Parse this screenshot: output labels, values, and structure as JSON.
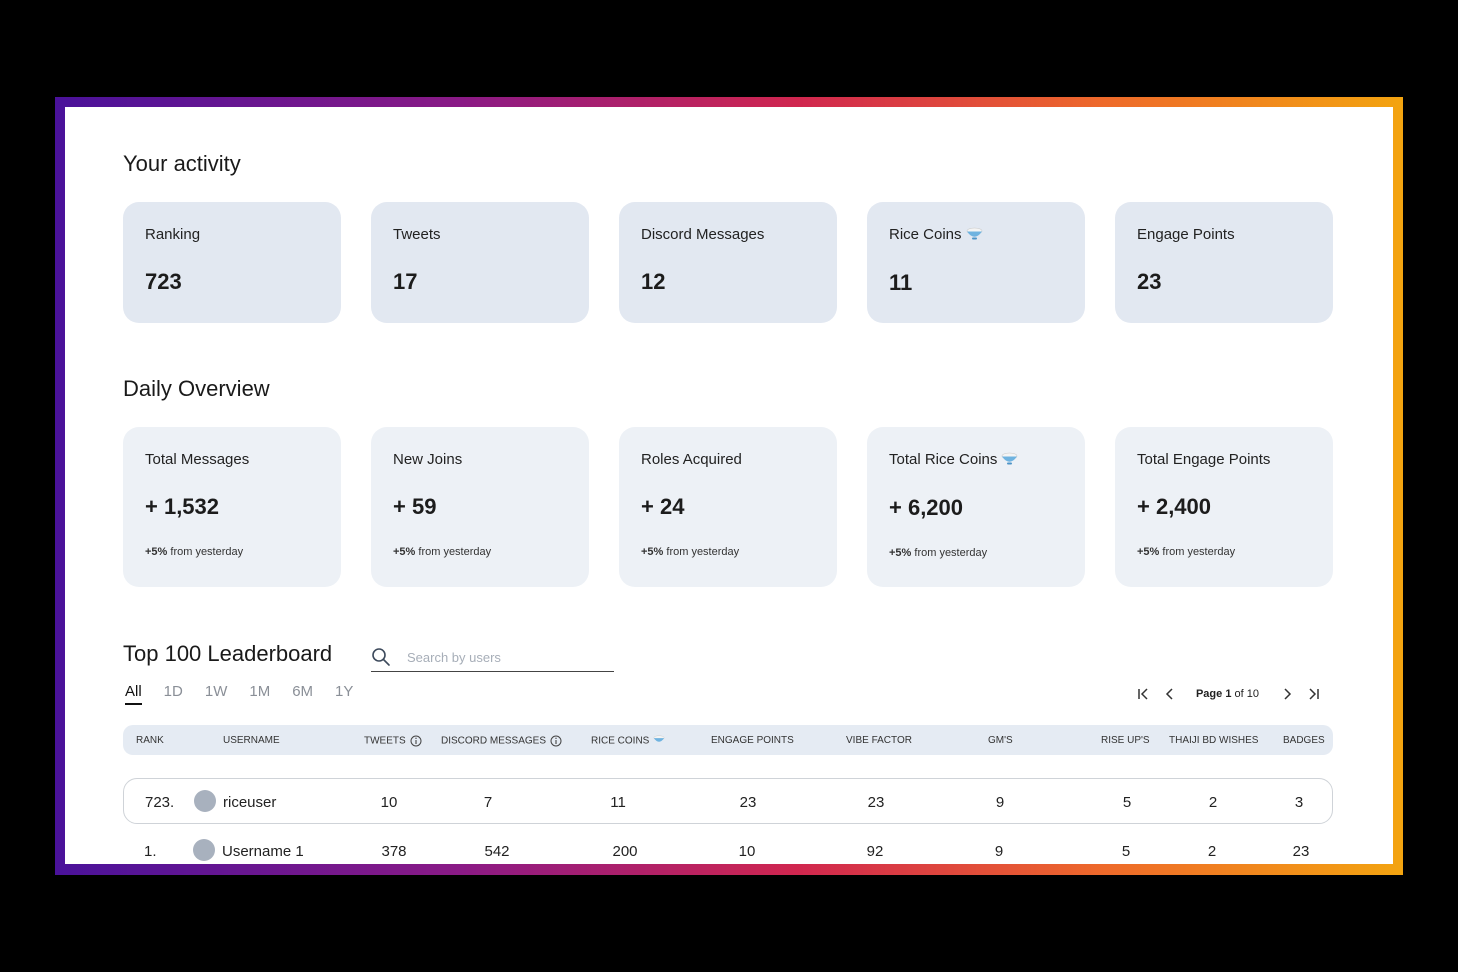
{
  "activity": {
    "title": "Your activity",
    "cards": [
      {
        "label": "Ranking",
        "value": "723"
      },
      {
        "label": "Tweets",
        "value": "17"
      },
      {
        "label": "Discord Messages",
        "value": "12"
      },
      {
        "label": "Rice Coins",
        "value": "11",
        "icon": "rice-bowl-icon"
      },
      {
        "label": "Engage Points",
        "value": "23"
      }
    ]
  },
  "daily": {
    "title": "Daily Overview",
    "cards": [
      {
        "label": "Total Messages",
        "value": "+ 1,532",
        "change": "+5%",
        "change_suffix": " from yesterday"
      },
      {
        "label": "New Joins",
        "value": "+ 59",
        "change": "+5%",
        "change_suffix": " from yesterday"
      },
      {
        "label": "Roles Acquired",
        "value": "+ 24",
        "change": "+5%",
        "change_suffix": " from yesterday"
      },
      {
        "label": "Total Rice Coins",
        "value": "+ 6,200",
        "change": "+5%",
        "change_suffix": " from yesterday",
        "icon": "rice-bowl-icon"
      },
      {
        "label": "Total Engage Points",
        "value": "+ 2,400",
        "change": "+5%",
        "change_suffix": " from yesterday"
      }
    ]
  },
  "leaderboard": {
    "title": "Top 100 Leaderboard",
    "search_placeholder": "Search by users",
    "tabs": [
      "All",
      "1D",
      "1W",
      "1M",
      "6M",
      "1Y"
    ],
    "active_tab": "All",
    "pager": {
      "prefix": "Page ",
      "current": "1",
      "middle": " of ",
      "total": "10"
    },
    "columns": [
      "Rank",
      "Username",
      "Tweets",
      "Discord Messages",
      "Rice Coins",
      "Engage Points",
      "Vibe Factor",
      "GM's",
      "Rise Up's",
      "Thaiji BD Wishes",
      "Badges"
    ],
    "rows": [
      {
        "rank": "723.",
        "username": "riceuser",
        "tweets": "10",
        "discord": "7",
        "rice": "11",
        "engage": "23",
        "vibe": "23",
        "gms": "9",
        "riseups": "5",
        "wishes": "2",
        "badges": "3"
      },
      {
        "rank": "1.",
        "username": "Username 1",
        "tweets": "378",
        "discord": "542",
        "rice": "200",
        "engage": "10",
        "vibe": "92",
        "gms": "9",
        "riseups": "5",
        "wishes": "2",
        "badges": "23"
      }
    ]
  },
  "colors": {
    "card_bg": "#e2e8f1",
    "daily_card_bg": "#edf1f6",
    "frame_start": "#4a129a",
    "frame_end": "#f3a410"
  }
}
